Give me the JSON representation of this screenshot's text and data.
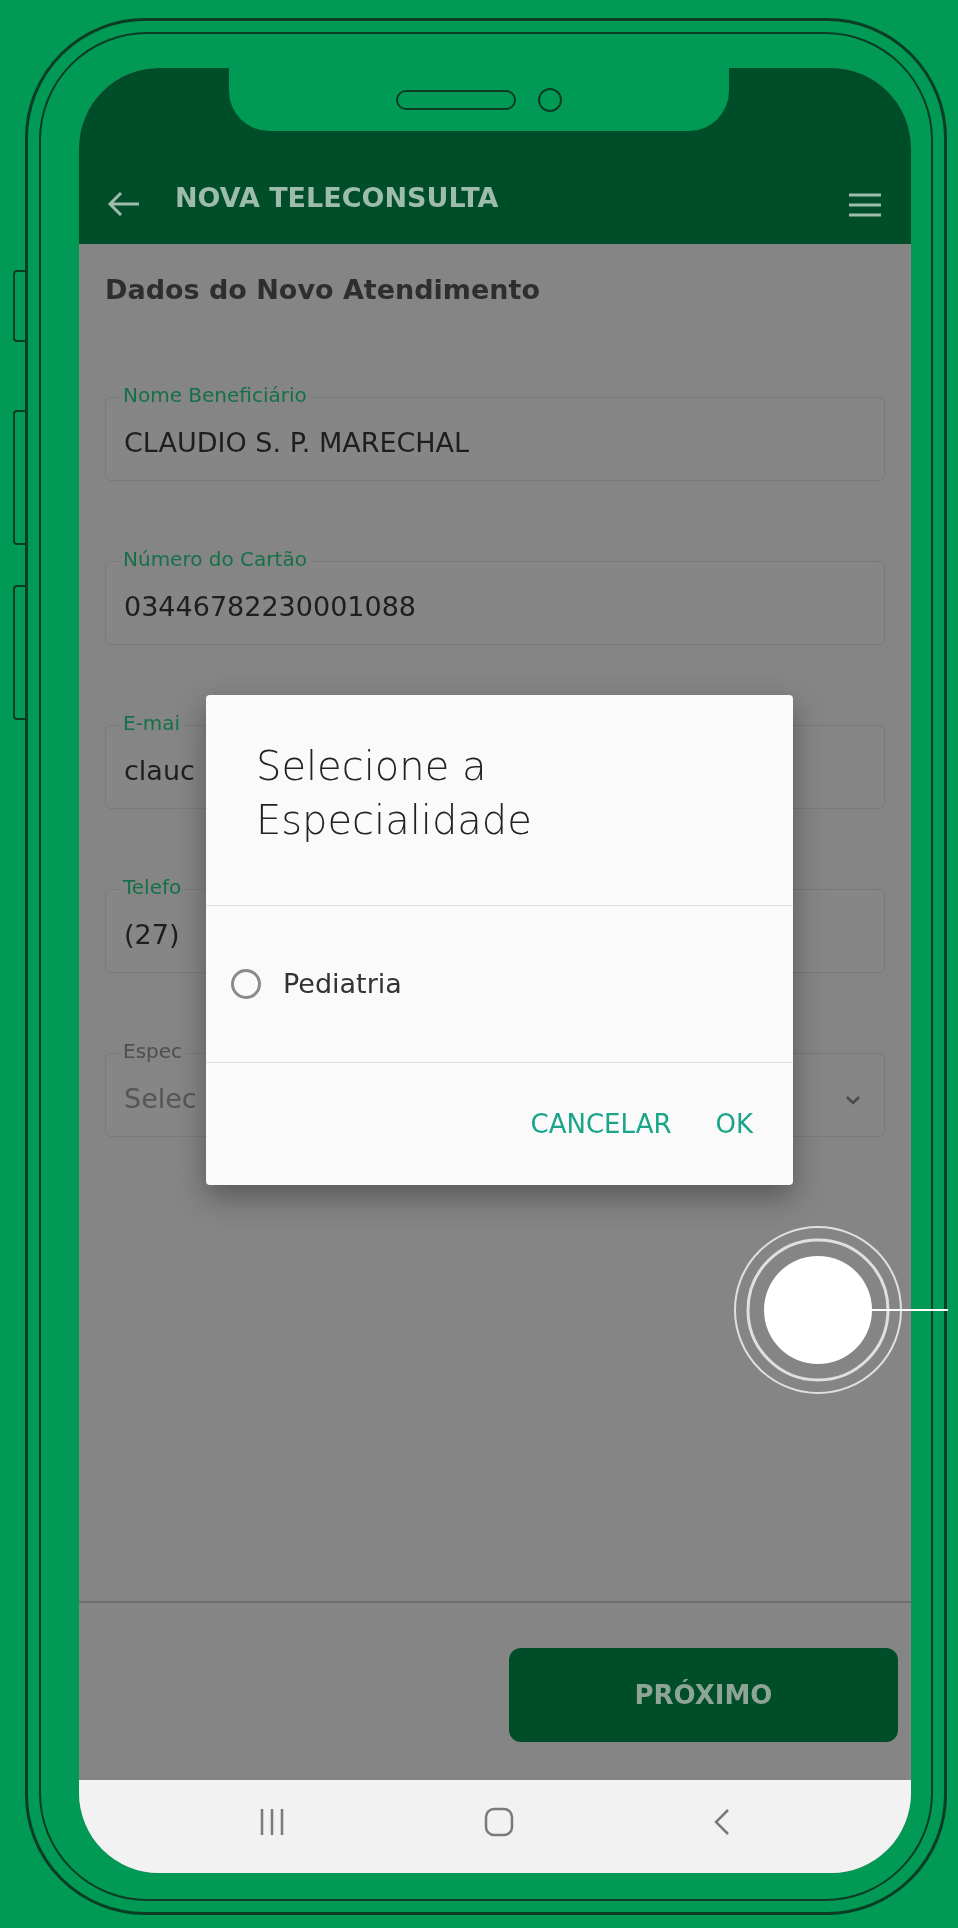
{
  "header": {
    "title": "NOVA TELECONSULTA"
  },
  "form": {
    "heading": "Dados do Novo Atendimento",
    "fields": [
      {
        "kind": "text",
        "label": "Nome Beneficiário",
        "value": "CLAUDIO S. P. MARECHAL"
      },
      {
        "kind": "text",
        "label": "Número do Cartão",
        "value": "03446782230001088"
      },
      {
        "kind": "text",
        "label": "E-mai",
        "value": "clauc"
      },
      {
        "kind": "text",
        "label": "Telefo",
        "value": "(27)"
      },
      {
        "kind": "select",
        "label": "Espec",
        "placeholder": "Selec"
      }
    ]
  },
  "dialog": {
    "title": "Selecione a Especialidade",
    "options": [
      {
        "label": "Pediatria",
        "selected": false
      }
    ],
    "buttons": [
      "CANCELAR",
      "OK"
    ]
  },
  "footer": {
    "button": "PRÓXIMO"
  }
}
